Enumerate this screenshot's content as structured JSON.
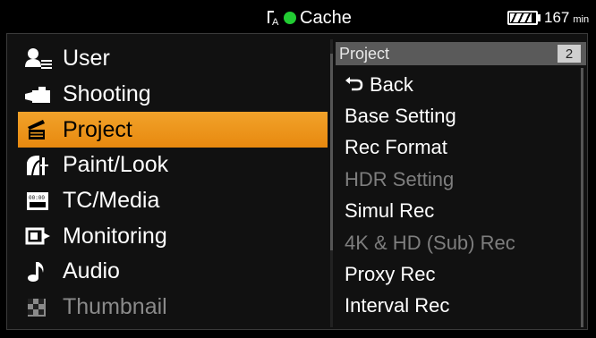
{
  "status_bar": {
    "cache_label": "Cache",
    "cache_dot_color": "#22cc33",
    "battery_minutes": "167",
    "battery_unit": "min",
    "battery_level_fraction": 0.8
  },
  "left_menu": {
    "items": [
      {
        "label": "User",
        "icon": "user-icon",
        "state": "normal"
      },
      {
        "label": "Shooting",
        "icon": "camera-icon",
        "state": "normal"
      },
      {
        "label": "Project",
        "icon": "clapperboard-icon",
        "state": "selected"
      },
      {
        "label": "Paint/Look",
        "icon": "paint-icon",
        "state": "normal"
      },
      {
        "label": "TC/Media",
        "icon": "timecode-icon",
        "state": "normal"
      },
      {
        "label": "Monitoring",
        "icon": "monitor-output-icon",
        "state": "normal"
      },
      {
        "label": "Audio",
        "icon": "music-note-icon",
        "state": "normal"
      },
      {
        "label": "Thumbnail",
        "icon": "thumbnail-grid-icon",
        "state": "disabled"
      }
    ],
    "accent_color": "#ee9a1e"
  },
  "right_panel": {
    "header_title": "Project",
    "page_number": "2",
    "items": [
      {
        "label": "Back",
        "icon": "back-arrow-icon",
        "state": "normal"
      },
      {
        "label": "Base Setting",
        "state": "normal"
      },
      {
        "label": "Rec Format",
        "state": "normal"
      },
      {
        "label": "HDR Setting",
        "state": "disabled"
      },
      {
        "label": "Simul Rec",
        "state": "normal"
      },
      {
        "label": "4K & HD (Sub) Rec",
        "state": "disabled"
      },
      {
        "label": "Proxy Rec",
        "state": "normal"
      },
      {
        "label": "Interval Rec",
        "state": "normal"
      }
    ]
  }
}
